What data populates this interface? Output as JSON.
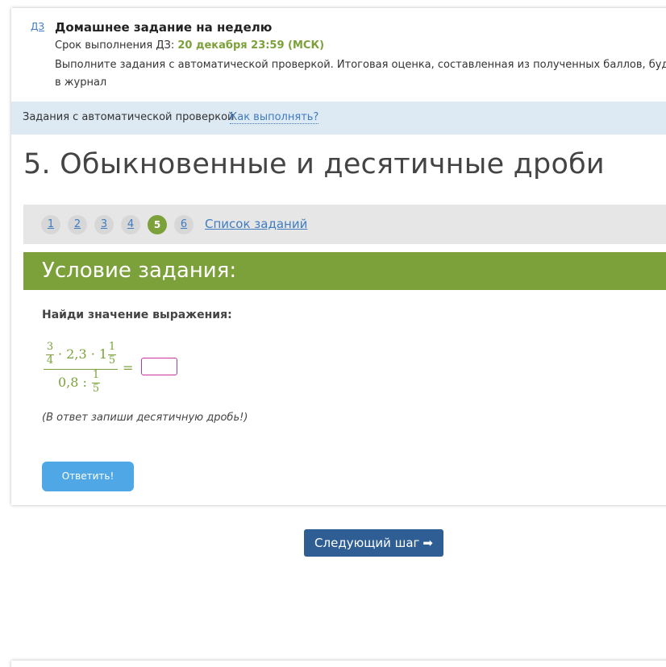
{
  "homework": {
    "badge": "ДЗ",
    "title": "Домашнее задание на неделю",
    "deadline_label": "Срок выполнения ДЗ: ",
    "deadline_value": "20 декабря 23:59 (МСК)",
    "description_line1": "Выполните задания с автоматической проверкой. Итоговая оценка, составленная из полученных баллов, будет выстав",
    "description_line2": "в журнал"
  },
  "auto_check": {
    "label": "Задания с автоматической проверкой",
    "how_link": "Как выполнять?"
  },
  "task": {
    "title": "5. Обыкновенные и десятичные дроби"
  },
  "pager": {
    "pages": [
      "1",
      "2",
      "3",
      "4",
      "5",
      "6"
    ],
    "active_page": "5",
    "task_list_link": "Список заданий"
  },
  "condition": {
    "header": "Условие задания:",
    "prompt": "Найди значение выражения:",
    "expression": {
      "n1_num": "3",
      "n1_den": "4",
      "mid1": "· 2,3 · 1",
      "n2_num": "1",
      "n2_den": "5",
      "denominator_text": "0,8 :",
      "n3_num": "1",
      "n3_den": "5",
      "equals": "="
    },
    "answer_value": "",
    "hint": "(В ответ запиши десятичную дробь!)",
    "answer_button": "Ответить!"
  },
  "next_step": {
    "label": "Следующий шаг",
    "arrow_icon": "arrow-right-icon"
  },
  "colors": {
    "accent_green": "#7ca13b",
    "link_blue": "#3f7cc0",
    "button_blue": "#4fa8e5",
    "next_button": "#2f5e94",
    "info_bar": "#dde9f3",
    "answer_border": "#cc3399"
  }
}
